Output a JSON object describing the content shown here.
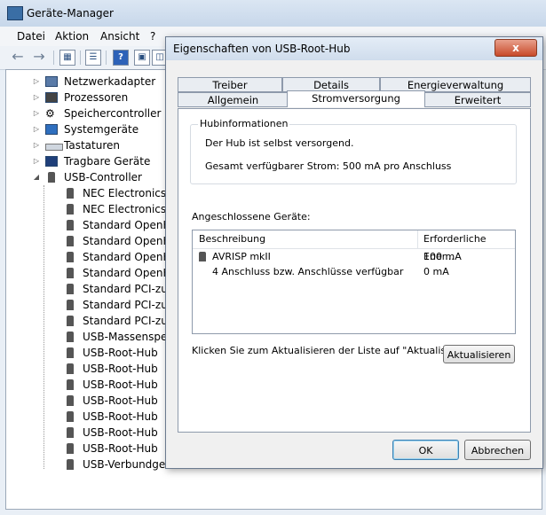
{
  "main_window": {
    "title": "Geräte-Manager",
    "menu": [
      "Datei",
      "Aktion",
      "Ansicht",
      "?"
    ]
  },
  "toolbar": {
    "icons": [
      "back-icon",
      "forward-icon",
      "properties-view-icon",
      "list-icon",
      "help-icon",
      "device-icon",
      "scan-icon"
    ]
  },
  "tree": {
    "categories": [
      {
        "label": "Netzwerkadapter",
        "icon": "network-adapter-icon"
      },
      {
        "label": "Prozessoren",
        "icon": "processor-icon"
      },
      {
        "label": "Speichercontroller",
        "icon": "storage-controller-icon"
      },
      {
        "label": "Systemgeräte",
        "icon": "system-device-icon"
      },
      {
        "label": "Tastaturen",
        "icon": "keyboard-icon"
      },
      {
        "label": "Tragbare Geräte",
        "icon": "portable-device-icon"
      },
      {
        "label": "USB-Controller",
        "icon": "usb-controller-icon"
      }
    ],
    "usb_children": [
      "NEC Electronics U",
      "NEC Electronics U",
      "Standard OpenHC",
      "Standard OpenHC",
      "Standard OpenHC",
      "Standard OpenHC",
      "Standard PCI-zu-U",
      "Standard PCI-zu-U",
      "Standard PCI-zu-U",
      "USB-Massenspeic",
      "USB-Root-Hub",
      "USB-Root-Hub",
      "USB-Root-Hub",
      "USB-Root-Hub",
      "USB-Root-Hub",
      "USB-Root-Hub",
      "USB-Root-Hub",
      "USB-Verbundgerä"
    ]
  },
  "dialog": {
    "title": "Eigenschaften von USB-Root-Hub",
    "close": "x",
    "tabs_back": [
      "Treiber",
      "Details",
      "Energieverwaltung"
    ],
    "tabs_front": [
      "Allgemein",
      "Stromversorgung",
      "Erweitert"
    ],
    "active_tab": "Stromversorgung",
    "hub_group": {
      "title": "Hubinformationen",
      "line1": "Der Hub ist selbst versorgend.",
      "line2": "Gesamt verfügbarer Strom: 500 mA pro Anschluss"
    },
    "devices": {
      "label": "Angeschlossene Geräte:",
      "columns": [
        "Beschreibung",
        "Erforderliche Ener..."
      ],
      "rows": [
        {
          "desc": "AVRISP mkII",
          "power": "100 mA",
          "icon": "usb-device-icon"
        },
        {
          "desc": "4 Anschluss bzw. Anschlüsse verfügbar",
          "power": "0 mA"
        }
      ]
    },
    "refresh_hint": "Klicken Sie zum Aktualisieren der Liste auf \"Aktualisieren\".",
    "refresh_button": "Aktualisieren",
    "ok_button": "OK",
    "cancel_button": "Abbrechen"
  }
}
